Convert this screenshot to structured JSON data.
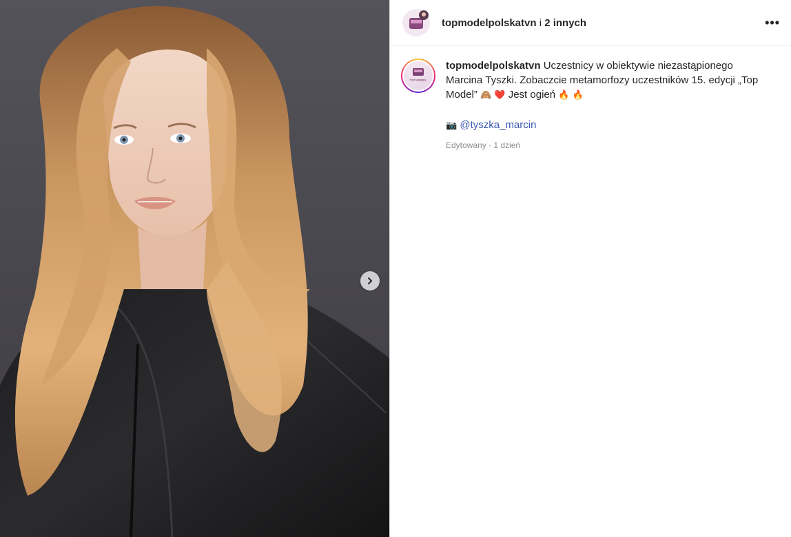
{
  "header": {
    "username": "topmodelpolskatvn",
    "conjunction": "i",
    "others": "2 innych",
    "more_icon": "ellipsis-icon",
    "more_glyph": "•••"
  },
  "avatar": {
    "logo_text": "TOP MODEL"
  },
  "caption": {
    "username": "topmodelpolskatvn",
    "text": "Uczestnicy w obiektywie niezastąpionego Marcina Tyszki. Zobaczcie metamorfozy uczestników 15. edycji „Top Model”",
    "emojis_1": "🙈 ❤️",
    "text_2": "Jest ogień",
    "emojis_2": "🔥 🔥",
    "camera_emoji": "📷",
    "mention": "@tyszka_marcin",
    "edited": "Edytowany",
    "time": "1 dzień"
  },
  "media": {
    "next_icon": "chevron-right-icon"
  },
  "colors": {
    "mention": "#3d5ab2",
    "meta": "#8e8e8e",
    "border": "#dbdbdb"
  }
}
